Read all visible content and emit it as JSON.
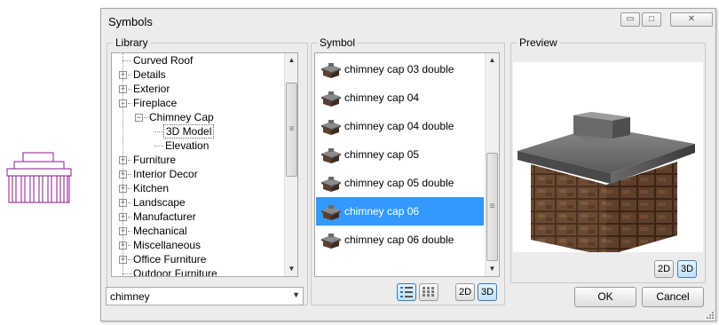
{
  "dialog": {
    "title": "Symbols",
    "window_buttons": {
      "minimize": "▭",
      "maximize": "□",
      "close": "✕"
    }
  },
  "library": {
    "label": "Library",
    "tree": [
      {
        "label": "Curved Roof",
        "level": 0,
        "expander": "none"
      },
      {
        "label": "Details",
        "level": 0,
        "expander": "plus"
      },
      {
        "label": "Exterior",
        "level": 0,
        "expander": "plus"
      },
      {
        "label": "Fireplace",
        "level": 0,
        "expander": "minus"
      },
      {
        "label": "Chimney Cap",
        "level": 1,
        "expander": "minus"
      },
      {
        "label": "3D Model",
        "level": 2,
        "expander": "none",
        "selected": true
      },
      {
        "label": "Elevation",
        "level": 2,
        "expander": "none"
      },
      {
        "label": "Furniture",
        "level": 0,
        "expander": "plus"
      },
      {
        "label": "Interior Decor",
        "level": 0,
        "expander": "plus"
      },
      {
        "label": "Kitchen",
        "level": 0,
        "expander": "plus"
      },
      {
        "label": "Landscape",
        "level": 0,
        "expander": "plus"
      },
      {
        "label": "Manufacturer",
        "level": 0,
        "expander": "plus"
      },
      {
        "label": "Mechanical",
        "level": 0,
        "expander": "plus"
      },
      {
        "label": "Miscellaneous",
        "level": 0,
        "expander": "plus"
      },
      {
        "label": "Office Furniture",
        "level": 0,
        "expander": "plus"
      },
      {
        "label": "Outdoor Furniture",
        "level": 0,
        "expander": "none"
      }
    ],
    "search": {
      "value": "chimney"
    }
  },
  "symbol": {
    "label": "Symbol",
    "items": [
      {
        "label": "chimney cap 03 double"
      },
      {
        "label": "chimney cap 04"
      },
      {
        "label": "chimney cap 04 double"
      },
      {
        "label": "chimney cap 05"
      },
      {
        "label": "chimney cap 05 double"
      },
      {
        "label": "chimney cap 06",
        "selected": true
      },
      {
        "label": "chimney cap 06 double"
      }
    ],
    "view_list_icon": "list-view-icon",
    "view_grid_icon": "grid-view-icon",
    "btn_2d": "2D",
    "btn_3d": "3D"
  },
  "preview": {
    "label": "Preview",
    "btn_2d": "2D",
    "btn_3d": "3D"
  },
  "buttons": {
    "ok": "OK",
    "cancel": "Cancel"
  },
  "colors": {
    "selection": "#3399ff",
    "symbol_outline": "#8b1a8b",
    "brick": "#5a3a26",
    "cap": "#6f6f6f"
  }
}
